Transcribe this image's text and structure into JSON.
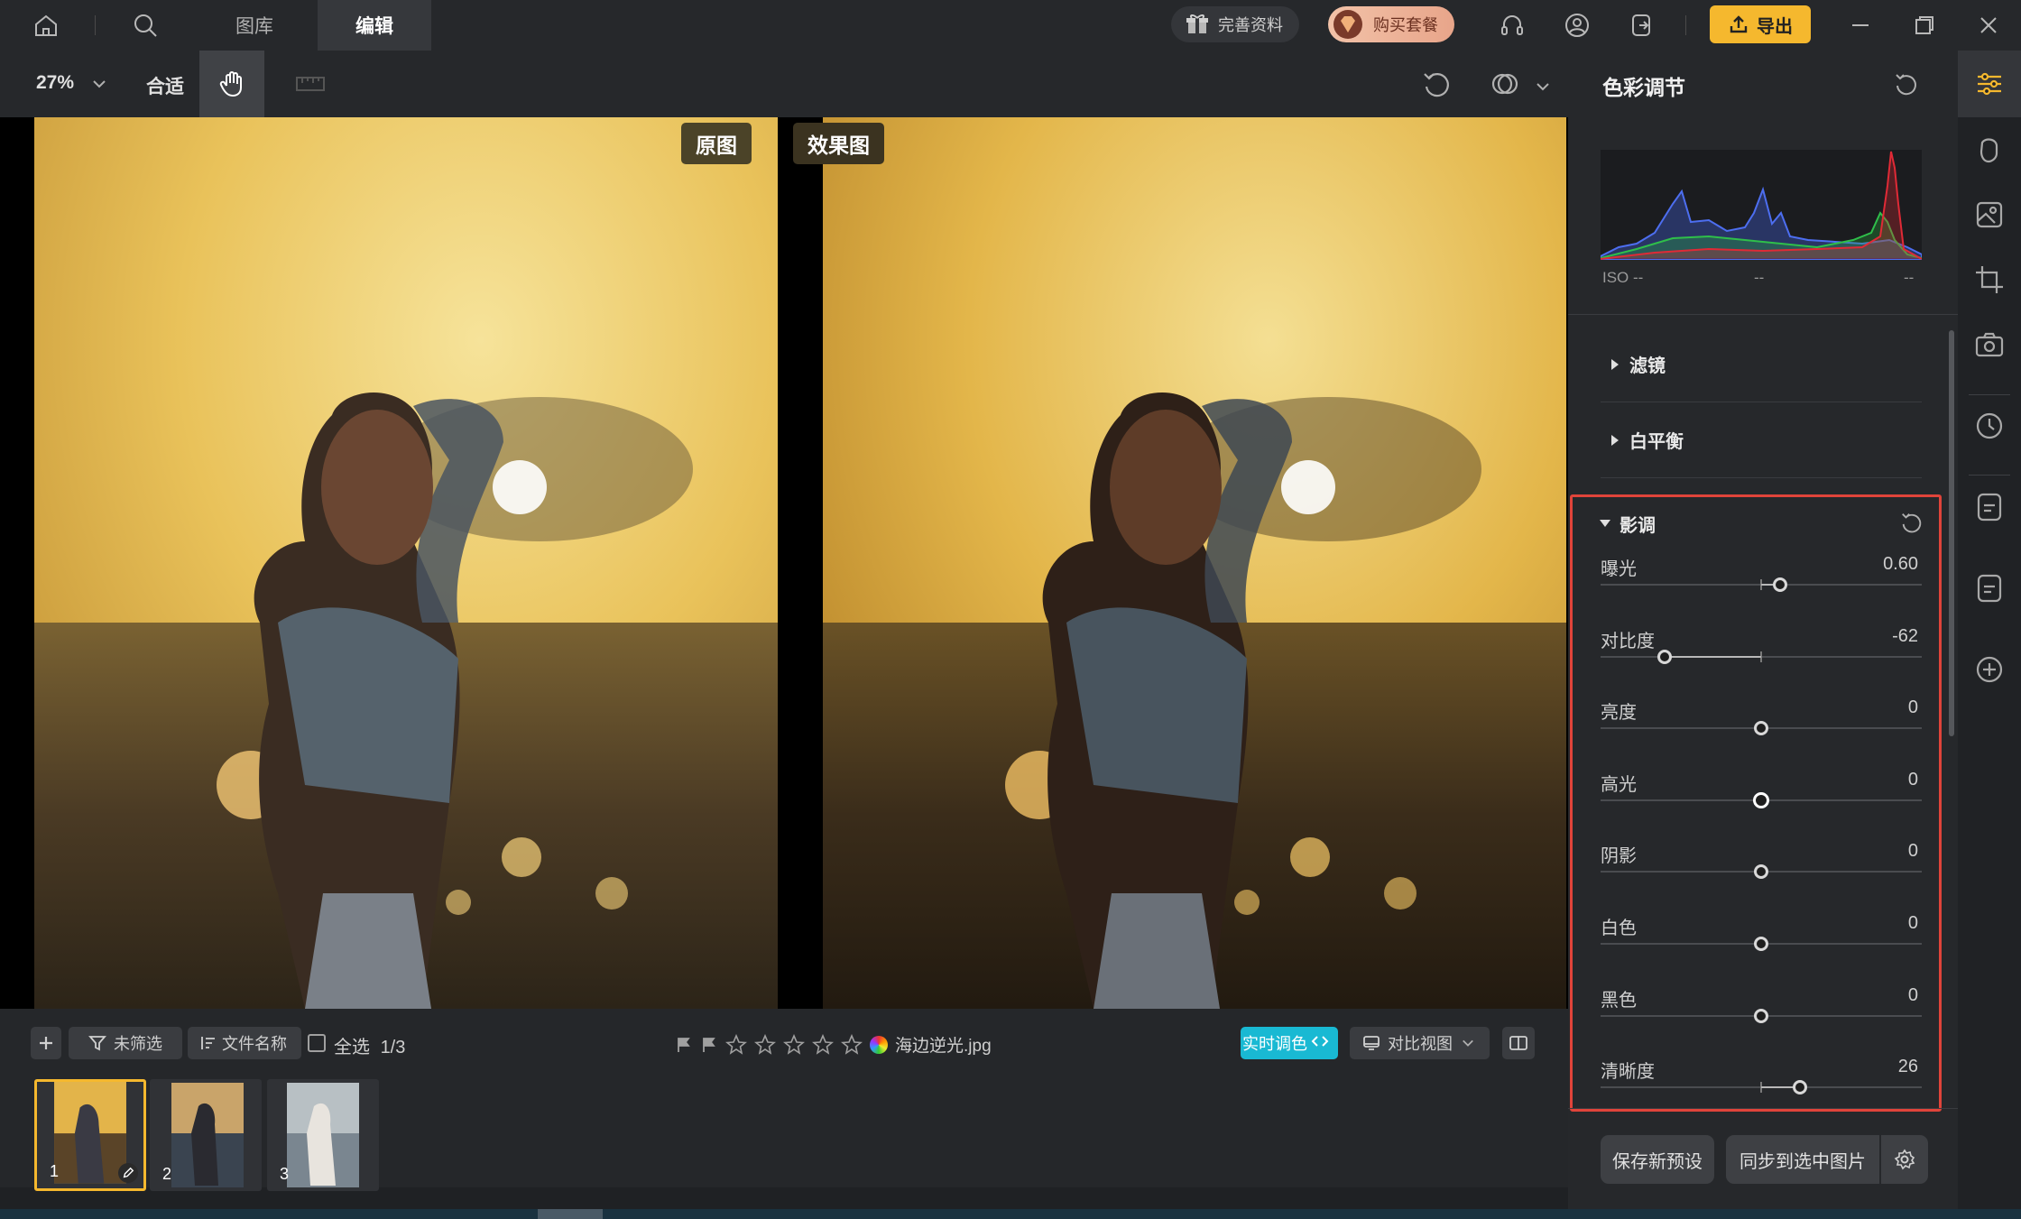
{
  "top_bar": {
    "tabs": [
      {
        "label": "图库"
      },
      {
        "label": "编辑"
      }
    ],
    "complete_profile_label": "完善资料",
    "buy_plan_label": "购买套餐",
    "export_label": "导出"
  },
  "toolbar": {
    "zoom_value": "27%",
    "fit_label": "合适"
  },
  "canvas": {
    "original_label": "原图",
    "effect_label": "效果图"
  },
  "bottom_bar": {
    "filter_label": "未筛选",
    "sort_label": "文件名称",
    "select_all_label": "全选",
    "count_label": "1/3",
    "filename": "海边逆光.jpg",
    "realtime_label": "实时调色",
    "compare_view_label": "对比视图",
    "thumbnails": [
      {
        "number": "1"
      },
      {
        "number": "2"
      },
      {
        "number": "3"
      }
    ]
  },
  "panel": {
    "title": "色彩调节",
    "histogram": {
      "iso_label": "ISO --",
      "mid_label": "--",
      "right_label": "--"
    },
    "sections": {
      "filter": "滤镜",
      "white_balance": "白平衡",
      "tone": "影调"
    },
    "sliders": [
      {
        "label": "曝光",
        "value": "0.60",
        "position": 0.56
      },
      {
        "label": "对比度",
        "value": "-62",
        "position": 0.2
      },
      {
        "label": "亮度",
        "value": "0",
        "position": 0.5
      },
      {
        "label": "高光",
        "value": "0",
        "position": 0.5
      },
      {
        "label": "阴影",
        "value": "0",
        "position": 0.5
      },
      {
        "label": "白色",
        "value": "0",
        "position": 0.5
      },
      {
        "label": "黑色",
        "value": "0",
        "position": 0.5
      },
      {
        "label": "清晰度",
        "value": "26",
        "position": 0.62
      }
    ],
    "save_preset_label": "保存新预设",
    "sync_label": "同步到选中图片"
  },
  "colors": {
    "accent_yellow": "#f5b82e",
    "highlight_red": "#e0443a",
    "realtime_cyan": "#19b9d3"
  }
}
